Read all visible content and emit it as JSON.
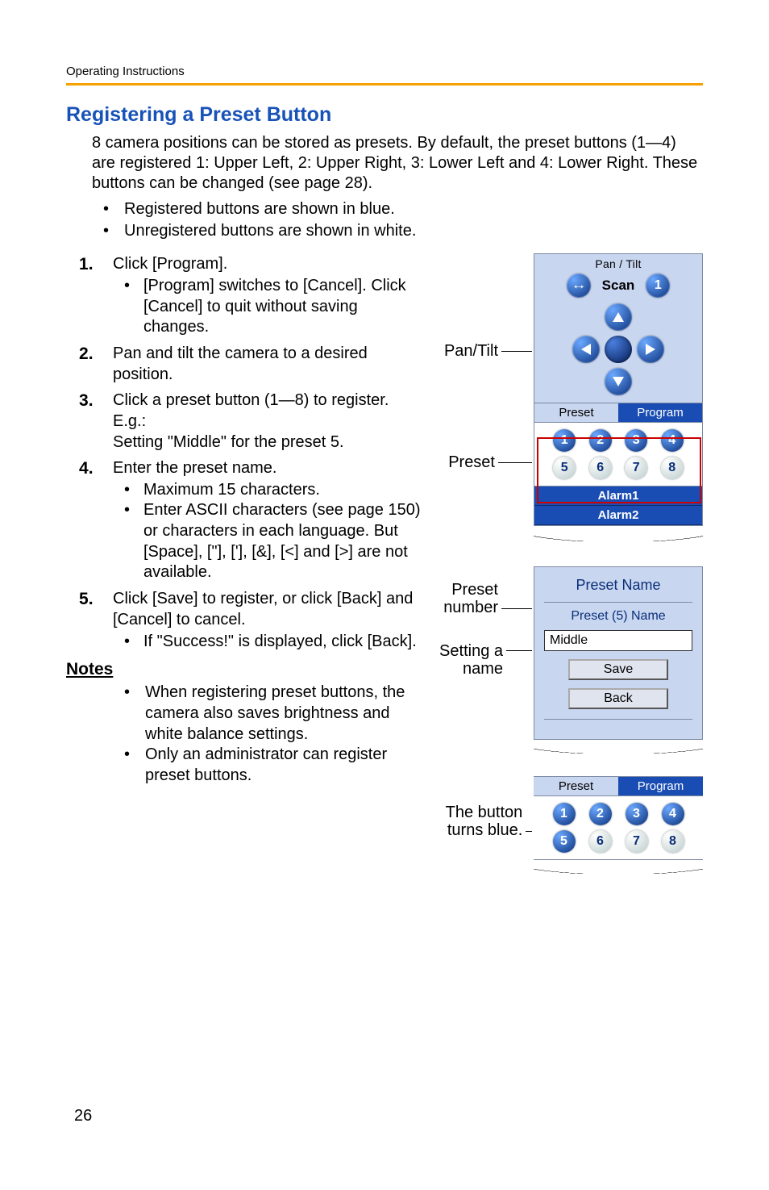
{
  "header": "Operating Instructions",
  "heading": "Registering a Preset Button",
  "intro": "8 camera positions can be stored as presets. By default, the preset buttons (1—4) are registered 1: Upper Left, 2: Upper Right, 3: Lower Left and 4: Lower Right. These buttons can be changed (see page 28).",
  "top_bullets": [
    "Registered buttons are shown in blue.",
    "Unregistered buttons are shown in white."
  ],
  "steps": [
    {
      "text": "Click [Program].",
      "sub": [
        "[Program] switches to [Cancel]. Click [Cancel] to quit without saving changes."
      ]
    },
    {
      "text": "Pan and tilt the camera to a desired position."
    },
    {
      "text": "Click a preset button (1—8) to register.",
      "eg_label": "E.g.:",
      "eg_text": "Setting \"Middle\" for the preset 5."
    },
    {
      "text": "Enter the preset name.",
      "sub": [
        "Maximum 15 characters.",
        "Enter ASCII characters (see page 150) or characters in each language. But [Space], [\"], ['], [&], [<] and [>] are not available."
      ]
    },
    {
      "text": "Click [Save] to register, or click [Back] and [Cancel] to cancel.",
      "sub": [
        "If \"Success!\" is displayed, click [Back]."
      ]
    }
  ],
  "notes_heading": "Notes",
  "notes": [
    "When registering preset buttons, the camera also saves brightness and white balance settings.",
    "Only an administrator can register preset buttons."
  ],
  "callouts": {
    "pan_tilt": "Pan/Tilt",
    "preset": "Preset",
    "preset_number": "Preset number",
    "setting_name": "Setting a name",
    "turns_blue": "The button turns blue."
  },
  "panel1": {
    "title": "Pan / Tilt",
    "scan_icon": "scan-icon",
    "scan_label": "Scan",
    "scan_num": "1",
    "preset_tab": "Preset",
    "program_tab": "Program",
    "buttons_registered": [
      "1",
      "2",
      "3",
      "4"
    ],
    "buttons_unregistered": [
      "5",
      "6",
      "7",
      "8"
    ],
    "alarm1": "Alarm1",
    "alarm2": "Alarm2"
  },
  "panel2": {
    "title": "Preset Name",
    "sub": "Preset (5) Name",
    "input_value": "Middle",
    "save": "Save",
    "back": "Back"
  },
  "panel3": {
    "preset_tab": "Preset",
    "program_tab": "Program",
    "row1": [
      "1",
      "2",
      "3",
      "4"
    ],
    "row2": [
      "5",
      "6",
      "7",
      "8"
    ],
    "highlighted": "5"
  },
  "page_number": "26"
}
